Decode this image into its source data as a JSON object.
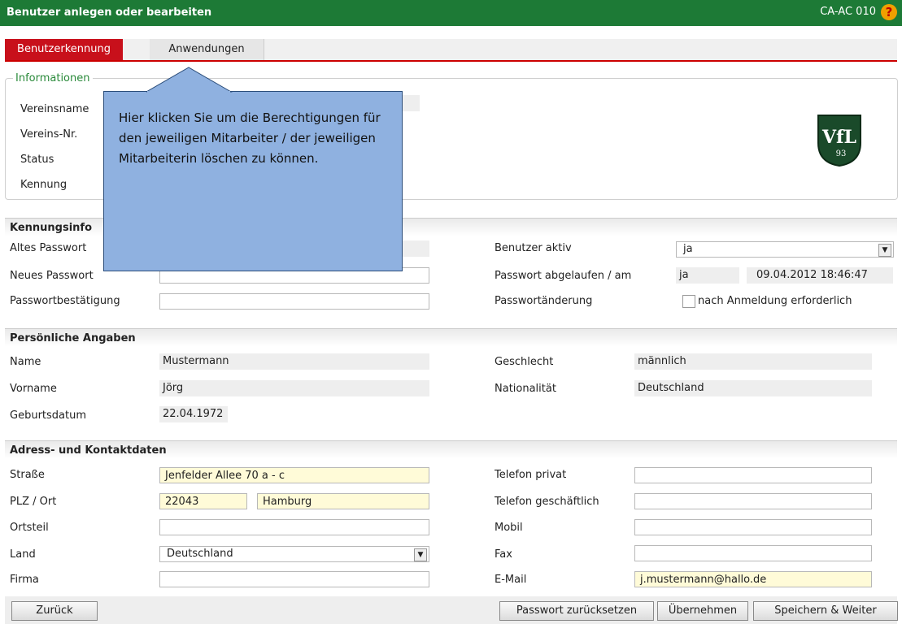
{
  "window": {
    "title": "Benutzer anlegen oder bearbeiten",
    "code": "CA-AC 010",
    "help_glyph": "?"
  },
  "tabs": [
    {
      "label": "Benutzerkennung",
      "active": true
    },
    {
      "label": "Anwendungen",
      "active": false
    }
  ],
  "info": {
    "legend": "Informationen",
    "labels": {
      "vereinsname": "Vereinsname",
      "vereins_nr": "Vereins-Nr.",
      "status": "Status",
      "kennung": "Kennung"
    },
    "logo_text": "VfL"
  },
  "callout": {
    "text": "Hier klicken Sie um die Berechtigungen für den jeweiligen Mitarbeiter / der jeweiligen Mitarbeiterin löschen zu können."
  },
  "kennung": {
    "section_title": "Kennungsinfo",
    "altes_passwort": "Altes Passwort",
    "neues_passwort": "Neues Passwort",
    "passwortbestaetigung": "Passwortbestätigung",
    "benutzer_aktiv_label": "Benutzer aktiv",
    "benutzer_aktiv_value": "ja",
    "abgelaufen_label": "Passwort abgelaufen / am",
    "abgelaufen_value": "ja",
    "abgelaufen_date": "09.04.2012 18:46:47",
    "aenderung_label": "Passwortänderung",
    "aenderung_checkbox_label": "nach Anmeldung erforderlich"
  },
  "personal": {
    "section_title": "Persönliche Angaben",
    "name_label": "Name",
    "name_value": "Mustermann",
    "vorname_label": "Vorname",
    "vorname_value": "Jörg",
    "geburtsdatum_label": "Geburtsdatum",
    "geburtsdatum_value": "22.04.1972",
    "geschlecht_label": "Geschlecht",
    "geschlecht_value": "männlich",
    "nationalitaet_label": "Nationalität",
    "nationalitaet_value": "Deutschland"
  },
  "address": {
    "section_title": "Adress- und Kontaktdaten",
    "strasse_label": "Straße",
    "strasse_value": "Jenfelder Allee 70 a - c",
    "plz_label": "PLZ / Ort",
    "plz_value": "22043",
    "ort_value": "Hamburg",
    "ortsteil_label": "Ortsteil",
    "land_label": "Land",
    "land_value": "Deutschland",
    "firma_label": "Firma",
    "tel_privat_label": "Telefon privat",
    "tel_geschaeftlich_label": "Telefon geschäftlich",
    "mobil_label": "Mobil",
    "fax_label": "Fax",
    "email_label": "E-Mail",
    "email_value": "j.mustermann@hallo.de"
  },
  "buttons": {
    "zurueck": "Zurück",
    "passwort_reset": "Passwort zurücksetzen",
    "uebernehmen": "Übernehmen",
    "speichern_weiter": "Speichern & Weiter"
  },
  "colors": {
    "titlebar": "#1d7a36",
    "active_tab": "#c8101b",
    "callout": "#8fb1e0",
    "required_field": "#fffbd8"
  }
}
